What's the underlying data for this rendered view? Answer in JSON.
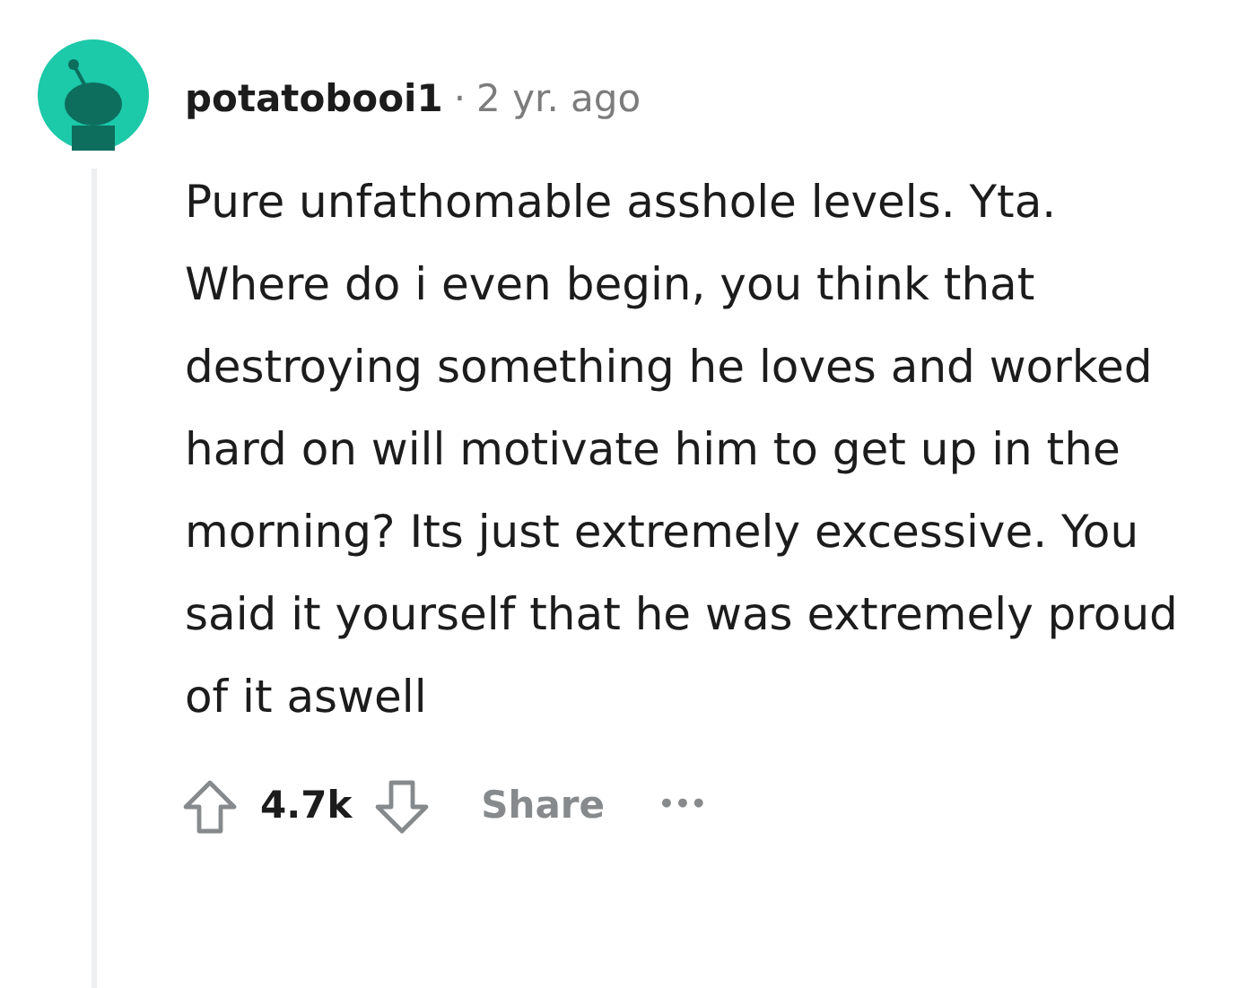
{
  "comment": {
    "author": "potatobooi1",
    "separator": "·",
    "time": "2 yr. ago",
    "body": "Pure unfathomable asshole levels. Yta. Where do i even begin, you think that destroying something he loves and worked hard on will motivate him to get up in the morning? Its just extremely excessive. You said it yourself that he was extremely proud of it aswell",
    "score": "4.7k",
    "share": "Share",
    "more": "•••"
  }
}
